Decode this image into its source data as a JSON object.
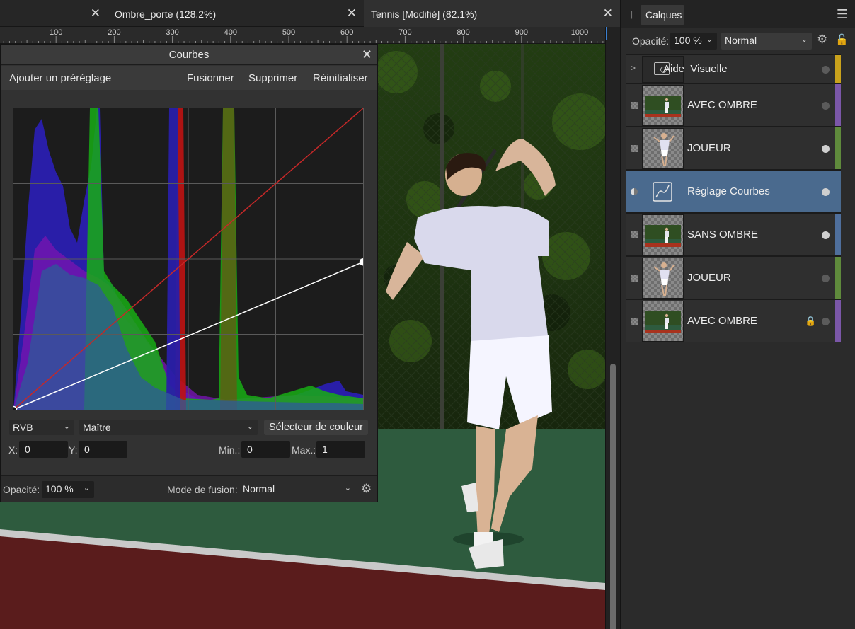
{
  "tabs": [
    {
      "label": "",
      "close": "✕"
    },
    {
      "label": "Ombre_porte (128.2%)",
      "close": "✕"
    },
    {
      "label": "Tennis [Modifié] (82.1%)",
      "close": "✕"
    }
  ],
  "ruler": {
    "ticks": [
      100,
      200,
      300,
      400,
      500,
      600,
      700,
      800,
      900,
      1000
    ]
  },
  "curves_panel": {
    "title": "Courbes",
    "close": "✕",
    "actions": {
      "add_preset": "Ajouter un préréglage",
      "merge": "Fusionner",
      "delete": "Supprimer",
      "reset": "Réinitialiser"
    },
    "channel_space": "RVB",
    "channel": "Maître",
    "color_picker": "Sélecteur de couleur",
    "x_label": "X:",
    "x_value": "0",
    "y_label": "Y:",
    "y_value": "0",
    "min_label": "Min.:",
    "min_value": "0",
    "max_label": "Max.:",
    "max_value": "1",
    "opacity_label": "Opacité:",
    "opacity_value": "100 %",
    "blend_label": "Mode de fusion:",
    "blend_value": "Normal",
    "curve_points": [
      [
        0,
        0
      ],
      [
        1,
        0.49
      ]
    ],
    "diagonal_color": "#c62828",
    "curve_color": "#ffffff"
  },
  "layers_panel": {
    "tab": "Calques",
    "opacity_label": "Opacité:",
    "opacity_value": "100 %",
    "blend_value": "Normal",
    "layers": [
      {
        "name": "Aide_Visuelle",
        "type": "group",
        "tag": "#c9a21c",
        "dot": false,
        "selected": false
      },
      {
        "name": "AVEC OMBRE",
        "type": "image",
        "tag": "#7b57a8",
        "dot": false,
        "selected": false
      },
      {
        "name": "JOUEUR",
        "type": "player",
        "tag": "#5f8a3c",
        "dot": true,
        "selected": false
      },
      {
        "name": "Réglage Courbes",
        "type": "adjustment",
        "tag": "#4a6a8e",
        "dot": true,
        "selected": true
      },
      {
        "name": "SANS OMBRE",
        "type": "image",
        "tag": "#4f6f9c",
        "dot": true,
        "selected": false
      },
      {
        "name": "JOUEUR",
        "type": "player",
        "tag": "#5f8a3c",
        "dot": false,
        "selected": false
      },
      {
        "name": "AVEC OMBRE",
        "type": "image",
        "tag": "#7b57a8",
        "dot": false,
        "selected": false,
        "locked": true
      }
    ]
  }
}
